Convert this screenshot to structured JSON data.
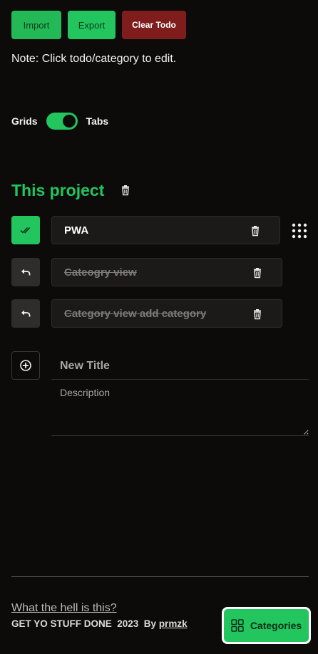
{
  "toolbar": {
    "import_label": "Import",
    "export_label": "Export",
    "clear_label": "Clear Todo"
  },
  "note": "Note: Click todo/category to edit.",
  "view_toggle": {
    "left_label": "Grids",
    "right_label": "Tabs",
    "selected": "Tabs"
  },
  "category": {
    "title": "This project",
    "delete_icon": "trash-icon"
  },
  "todos": [
    {
      "label": "PWA",
      "done": false,
      "status_icon": "check-double-icon"
    },
    {
      "label": "Cateogry view",
      "done": true,
      "status_icon": "undo-icon"
    },
    {
      "label": "Category view add category",
      "done": true,
      "status_icon": "undo-icon"
    }
  ],
  "new_todo": {
    "add_icon": "plus-circle-icon",
    "title_placeholder": "New Title",
    "description_placeholder": "Description"
  },
  "footer": {
    "about_link": "What the hell is this?",
    "credit_text": "GET YO STUFF DONE  2023  By ",
    "author": "prmzk"
  },
  "categories_button": {
    "label": "Categories",
    "icon": "grid-icon"
  },
  "colors": {
    "accent": "#22c55e",
    "danger": "#7f1d1d",
    "background": "#0c0b0a"
  }
}
